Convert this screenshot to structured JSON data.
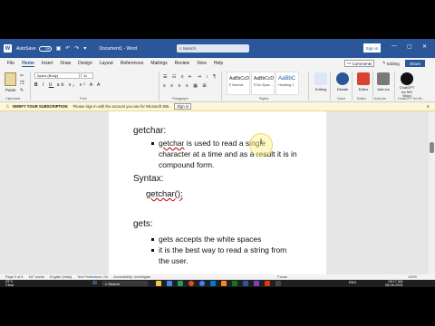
{
  "titlebar": {
    "autosave_label": "AutoSave",
    "autosave_state": "Off",
    "doc_title": "Document1 - Word",
    "search_placeholder": "Search",
    "signin_label": "Sign in"
  },
  "menu": {
    "tabs": [
      "File",
      "Home",
      "Insert",
      "Draw",
      "Design",
      "Layout",
      "References",
      "Mailings",
      "Review",
      "View",
      "Help"
    ],
    "active_tab": "Home",
    "comments_label": "Comments",
    "editing_label": "Editing",
    "share_label": "Share"
  },
  "ribbon": {
    "paste_label": "Paste",
    "clipboard_label": "Clipboard",
    "font_name": "Aptos (Body)",
    "font_size": "11",
    "font_group_label": "Font",
    "paragraph_label": "Paragraph",
    "styles": [
      {
        "sample": "AaBbCcD",
        "name": "¶ Normal"
      },
      {
        "sample": "AaBbCcD",
        "name": "¶ No Spac..."
      },
      {
        "sample": "AaBbC",
        "name": "Heading 1"
      }
    ],
    "styles_label": "Styles",
    "editing_btn": "Editing",
    "dictate_btn": "Dictate",
    "voice_label": "Voice",
    "editor_btn": "Editor",
    "editor_group_label": "Editor",
    "addins_btn": "Add-ins",
    "addins_label": "Add-ins",
    "chatgpt_btn": "ChatGPT for MS Word",
    "chatgpt_label": "ChatGPT for Mi..."
  },
  "notification": {
    "title": "VERIFY YOUR SUBSCRIPTION",
    "message": "Please sign in with the account you use for Microsoft 365.",
    "button": "Sign in"
  },
  "document": {
    "getchar_heading": "getchar:",
    "getchar_bullet_word": "getchar",
    "getchar_bullet_line1": " is used to read a single",
    "getchar_bullet_line2": "character at a time and as a result it is in",
    "getchar_bullet_line3": "compound form.",
    "syntax_heading": "Syntax:",
    "syntax_code": "getchar();",
    "gets_heading": "gets:",
    "gets_bullet1": "gets accepts the white spaces",
    "gets_bullet2_line1": "it is the best way to read a string from",
    "gets_bullet2_line2": "the user."
  },
  "statusbar": {
    "page": "Page 3 of 5",
    "words": "167 words",
    "language": "English (India)",
    "predictions": "Text Predictions: On",
    "accessibility": "Accessibility: Investigate",
    "focus": "Focus",
    "zoom": "100%"
  },
  "taskbar": {
    "weather_temp": "29°C",
    "weather_desc": "Clear",
    "search_placeholder": "Search",
    "lang": "ENG",
    "time": "08:17 AM",
    "date": "28-06-2023"
  }
}
